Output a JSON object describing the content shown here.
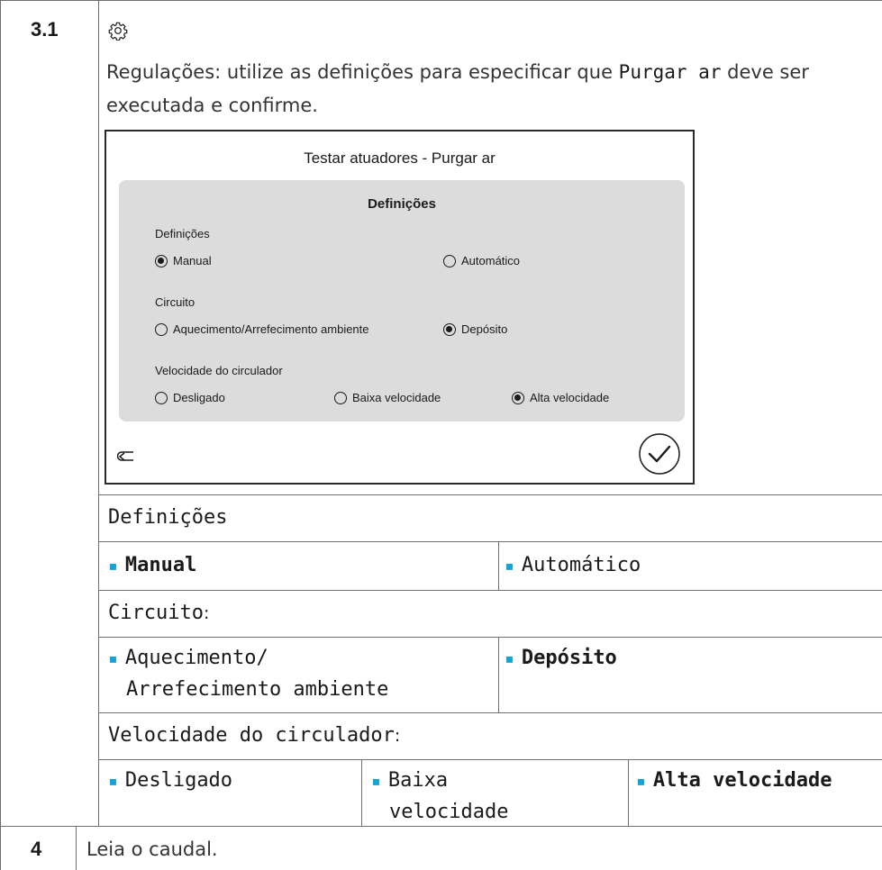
{
  "step_primary": {
    "number": "3.1",
    "icon": "gear-icon",
    "intro_prefix": "Regulações: utilize as definições para especificar que ",
    "intro_highlight": "Purgar ar",
    "intro_suffix": " deve ser executada e confirme."
  },
  "screen": {
    "title": "Testar atuadores  -  Purgar ar",
    "panel_title": "Definições",
    "groups": [
      {
        "label": "Definições",
        "options": [
          {
            "label": "Manual",
            "selected": true
          },
          {
            "label": "Automático",
            "selected": false
          }
        ]
      },
      {
        "label": "Circuito",
        "options": [
          {
            "label": "Aquecimento/Arrefecimento ambiente",
            "selected": false
          },
          {
            "label": "Depósito",
            "selected": true
          }
        ]
      },
      {
        "label": "Velocidade do circulador",
        "options": [
          {
            "label": "Desligado",
            "selected": false
          },
          {
            "label": "Baixa velocidade",
            "selected": false
          },
          {
            "label": "Alta velocidade",
            "selected": true
          }
        ]
      }
    ],
    "back_icon": "back-arrow-icon",
    "confirm_icon": "checkmark-circle-icon"
  },
  "table": {
    "definicoes_header": "Definições",
    "definicoes_options": [
      "Manual",
      "Automático"
    ],
    "circuito_header": "Circuito",
    "circuito_options": [
      "Aquecimento/",
      "Arrefecimento ambiente",
      "Depósito"
    ],
    "velocidade_header": "Velocidade do circulador",
    "velocidade_options": [
      "Desligado",
      "Baixa",
      "velocidade",
      "Alta velocidade"
    ],
    "colon": ":",
    "bullet": "▪"
  },
  "step_next": {
    "number": "4",
    "text": "Leia o caudal."
  },
  "colors": {
    "accent_bullet": "#12a5d6",
    "panel_bg": "#dcdcdc",
    "rule": "#6e6e6e"
  }
}
